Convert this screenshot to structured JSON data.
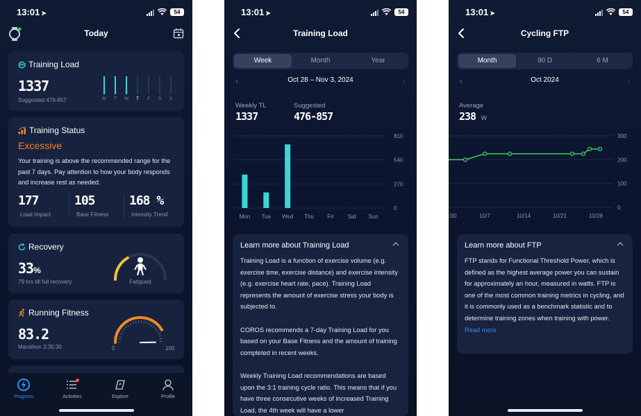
{
  "status": {
    "time": "13:01",
    "battery": "54"
  },
  "screen1": {
    "title": "Today",
    "training_load": {
      "title": "Training Load",
      "value": "1337",
      "suggested": "Suggested 476-857",
      "days": [
        "M",
        "T",
        "W",
        "T",
        "F",
        "S",
        "S"
      ],
      "levels": [
        0.9,
        0.8,
        0.9,
        0,
        0,
        0,
        0
      ]
    },
    "training_status": {
      "title": "Training Status",
      "state": "Excessive",
      "description": "Your training is above the recommended range for the past 7 days. Pay attention to how your body responds and increase rest as needed.",
      "metrics": [
        {
          "value": "177",
          "label": "Load Impact"
        },
        {
          "value": "105",
          "label": "Base Fitness"
        },
        {
          "value": "168",
          "unit": "%",
          "label": "Intensity Trend"
        }
      ]
    },
    "recovery": {
      "title": "Recovery",
      "value": "33",
      "unit": "%",
      "detail": "79 hrs till full recovery",
      "state": "Fatigued",
      "level": 0.33
    },
    "running_fitness": {
      "title": "Running Fitness",
      "value": "83.2",
      "detail": "Marathon 3:35:30",
      "gauge_min": "0",
      "gauge_max": "100",
      "level": 0.83
    },
    "tabs": [
      {
        "label": "Progress",
        "icon": "progress-icon",
        "active": true
      },
      {
        "label": "Activities",
        "icon": "activities-icon",
        "badge": true
      },
      {
        "label": "Explore",
        "icon": "explore-icon"
      },
      {
        "label": "Profile",
        "icon": "profile-icon"
      }
    ]
  },
  "screen2": {
    "title": "Training Load",
    "segments": [
      "Week",
      "Month",
      "Year"
    ],
    "active_segment": "Week",
    "date_range": "Oct 28 – Nov 3, 2024",
    "weekly_label": "Weekly TL",
    "weekly_value": "1337",
    "suggested_label": "Suggested",
    "suggested_value": "476-857",
    "learn_title": "Learn more about Training Load",
    "learn_paragraphs": [
      "Training Load is a function of exercise volume (e.g. exercise time, exercise distance) and exercise intensity (e.g. exercise heart rate, pace). Training Load represents the amount of exercise stress your body is subjected to.",
      "COROS recommends a 7-day Training Load for you based on your Base Fitness and the amount of training completed in recent weeks.",
      "Weekly Training Load recommendations are based upon the 3:1 training cycle ratio. This means that if you have three consecutive weeks of increased Training Load, the 4th week will have a lower"
    ]
  },
  "screen3": {
    "title": "Cycling FTP",
    "segments": [
      "Month",
      "90 D",
      "6 M"
    ],
    "active_segment": "Month",
    "date_range": "Oct 2024",
    "average_label": "Average",
    "average_value": "238",
    "average_unit": "W",
    "learn_title": "Learn more about FTP",
    "learn_text": "FTP stands for Functional Threshold Power, which is defined as the highest average power you can sustain for approximately an hour, measured in watts. FTP is one of the most common training metrics in cycling, and it is commonly used as a benchmark statistic and to determine training zones when training with power.",
    "read_more": "Read more"
  },
  "chart_data": [
    {
      "type": "bar",
      "categories": [
        "Mon",
        "Tue",
        "Wed",
        "Thu",
        "Fri",
        "Sat",
        "Sun"
      ],
      "values": [
        375,
        175,
        715,
        0,
        0,
        0,
        0
      ],
      "yticks": [
        "810",
        "540",
        "270",
        "0"
      ],
      "ylim": [
        0,
        810
      ],
      "color": "#3ad6d3"
    },
    {
      "type": "line",
      "x": [
        "9/30",
        "10/4",
        "10/7",
        "10/14",
        "10/21",
        "10/26",
        "10/28",
        "10/29",
        "10/31"
      ],
      "values": [
        200,
        200,
        225,
        225,
        225,
        225,
        225,
        245,
        245
      ],
      "xticks": [
        "/30",
        "10/7",
        "10/14",
        "10/21",
        "10/28"
      ],
      "yticks": [
        "300",
        "200",
        "100",
        "0"
      ],
      "ylim": [
        0,
        300
      ],
      "color": "#3ecf5a"
    }
  ]
}
